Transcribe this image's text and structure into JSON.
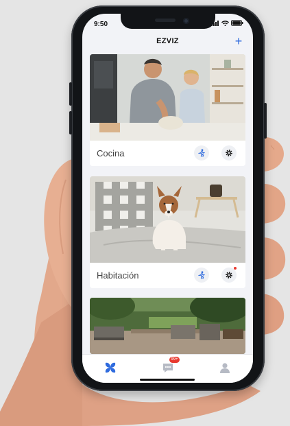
{
  "status_bar": {
    "time": "9:50"
  },
  "header": {
    "title": "EZVIZ",
    "add_label": "+"
  },
  "cameras": [
    {
      "name": "Cocina"
    },
    {
      "name": "Habitación"
    },
    {
      "name": ""
    }
  ],
  "tab_bar": {
    "messages_badge": "99+"
  },
  "colors": {
    "accent": "#2f6bde",
    "badge": "#e8392f",
    "screen_bg": "#f2f3f7"
  }
}
